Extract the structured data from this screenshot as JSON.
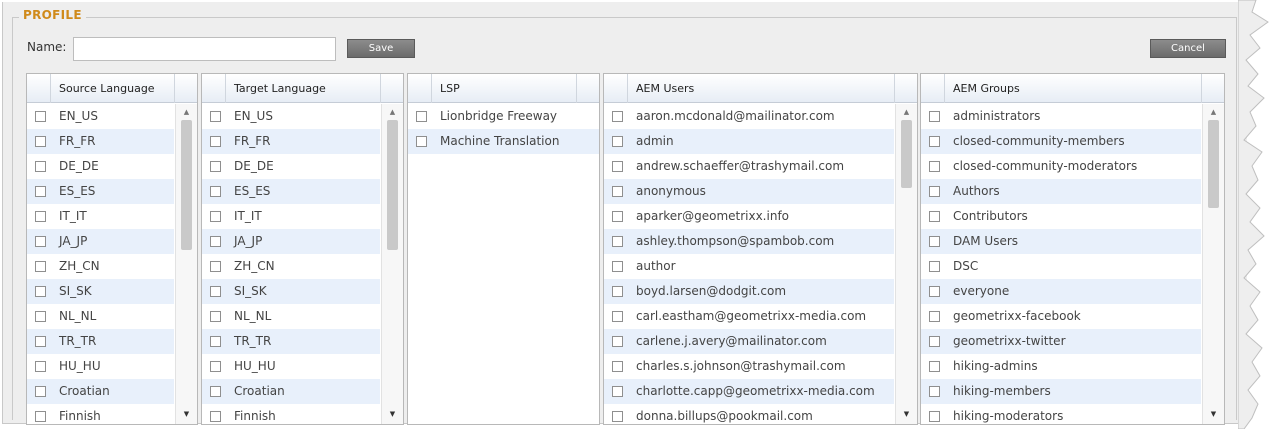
{
  "profile": {
    "legend": "PROFILE",
    "name_label": "Name:",
    "name_value": "",
    "save_label": "Save",
    "cancel_label": "Cancel"
  },
  "columns": [
    {
      "header": "Source Language",
      "rows": [
        "EN_US",
        "FR_FR",
        "DE_DE",
        "ES_ES",
        "IT_IT",
        "JA_JP",
        "ZH_CN",
        "SI_SK",
        "NL_NL",
        "TR_TR",
        "HU_HU",
        "Croatian",
        "Finnish"
      ],
      "scrollbar": true,
      "scroll_up": "▲",
      "scroll_down": "▼"
    },
    {
      "header": "Target Language",
      "rows": [
        "EN_US",
        "FR_FR",
        "DE_DE",
        "ES_ES",
        "IT_IT",
        "JA_JP",
        "ZH_CN",
        "SI_SK",
        "NL_NL",
        "TR_TR",
        "HU_HU",
        "Croatian",
        "Finnish"
      ],
      "scrollbar": true,
      "scroll_up": "▲",
      "scroll_down": "▼"
    },
    {
      "header": "LSP",
      "rows": [
        "Lionbridge Freeway",
        "Machine Translation"
      ],
      "scrollbar": false
    },
    {
      "header": "AEM Users",
      "rows": [
        "aaron.mcdonald@mailinator.com",
        "admin",
        "andrew.schaeffer@trashymail.com",
        "anonymous",
        "aparker@geometrixx.info",
        "ashley.thompson@spambob.com",
        "author",
        "boyd.larsen@dodgit.com",
        "carl.eastham@geometrixx-media.com",
        "carlene.j.avery@mailinator.com",
        "charles.s.johnson@trashymail.com",
        "charlotte.capp@geometrixx-media.com",
        "donna.billups@pookmail.com"
      ],
      "scrollbar": true,
      "scroll_up": "▲",
      "scroll_down": "▼"
    },
    {
      "header": "AEM Groups",
      "rows": [
        "administrators",
        "closed-community-members",
        "closed-community-moderators",
        "Authors",
        "Contributors",
        "DAM Users",
        "DSC",
        "everyone",
        "geometrixx-facebook",
        "geometrixx-twitter",
        "hiking-admins",
        "hiking-members",
        "hiking-moderators"
      ],
      "scrollbar": true,
      "scroll_up": "▲",
      "scroll_down": "▼"
    }
  ]
}
